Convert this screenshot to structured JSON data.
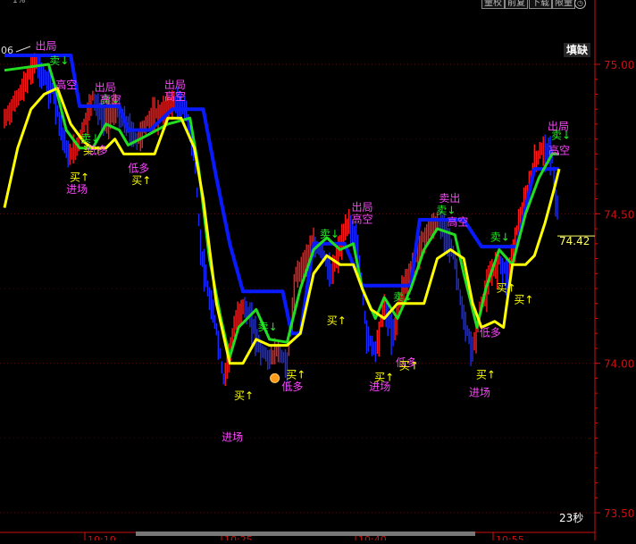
{
  "toolbar": {
    "buttons": [
      "量校",
      "前复",
      "下载",
      "限量"
    ],
    "topleft_label": "1%",
    "left_label": "06",
    "status_label": "填缺",
    "time_label": "23秒"
  },
  "colors": {
    "up": "#ff1a1a",
    "down": "#1a2aff",
    "blue_band": "#0a1aff",
    "green_line": "#22dd22",
    "yellow_line": "#ffff00",
    "axis": "#cc1111",
    "label_magenta": "#ff44ff",
    "label_yellow": "#ffff00",
    "label_green": "#22ee22"
  },
  "chart_data": {
    "type": "line",
    "ylim": [
      73.48,
      75.12
    ],
    "y_ticks": [
      "75.00",
      "74.50",
      "74.00",
      "73.50"
    ],
    "x_ticks": [
      "10:10",
      "10:25",
      "10:40",
      "10:55"
    ],
    "last_price": "74.42",
    "price": [
      [
        0,
        74.82
      ],
      [
        12,
        74.88
      ],
      [
        25,
        74.95
      ],
      [
        35,
        75.02
      ],
      [
        45,
        74.96
      ],
      [
        55,
        74.92
      ],
      [
        65,
        74.78
      ],
      [
        72,
        74.7
      ],
      [
        80,
        74.72
      ],
      [
        90,
        74.8
      ],
      [
        100,
        74.9
      ],
      [
        112,
        74.82
      ],
      [
        125,
        74.86
      ],
      [
        140,
        74.8
      ],
      [
        150,
        74.75
      ],
      [
        165,
        74.83
      ],
      [
        180,
        74.85
      ],
      [
        192,
        74.88
      ],
      [
        205,
        74.86
      ],
      [
        215,
        74.7
      ],
      [
        222,
        74.4
      ],
      [
        230,
        74.25
      ],
      [
        240,
        74.12
      ],
      [
        248,
        73.95
      ],
      [
        255,
        74.05
      ],
      [
        262,
        74.15
      ],
      [
        270,
        74.2
      ],
      [
        280,
        74.15
      ],
      [
        290,
        74.05
      ],
      [
        300,
        74.02
      ],
      [
        310,
        74.05
      ],
      [
        320,
        74.0
      ],
      [
        330,
        74.3
      ],
      [
        340,
        74.35
      ],
      [
        350,
        74.4
      ],
      [
        360,
        74.38
      ],
      [
        370,
        74.3
      ],
      [
        380,
        74.4
      ],
      [
        390,
        74.48
      ],
      [
        400,
        74.4
      ],
      [
        410,
        74.1
      ],
      [
        420,
        74.05
      ],
      [
        430,
        74.2
      ],
      [
        440,
        74.1
      ],
      [
        450,
        74.25
      ],
      [
        460,
        74.32
      ],
      [
        470,
        74.4
      ],
      [
        480,
        74.45
      ],
      [
        490,
        74.48
      ],
      [
        500,
        74.45
      ],
      [
        510,
        74.35
      ],
      [
        520,
        74.15
      ],
      [
        530,
        74.05
      ],
      [
        540,
        74.2
      ],
      [
        550,
        74.3
      ],
      [
        560,
        74.35
      ],
      [
        570,
        74.3
      ],
      [
        580,
        74.45
      ],
      [
        590,
        74.55
      ],
      [
        600,
        74.68
      ],
      [
        610,
        74.73
      ],
      [
        620,
        74.7
      ],
      [
        625,
        74.52
      ]
    ],
    "series": [
      {
        "points": [
          [
            0,
            75.03
          ],
          [
            75,
            75.03
          ],
          [
            85,
            74.86
          ],
          [
            130,
            74.86
          ],
          [
            140,
            74.78
          ],
          [
            165,
            74.78
          ],
          [
            190,
            74.85
          ],
          [
            225,
            74.85
          ],
          [
            240,
            74.62
          ],
          [
            255,
            74.4
          ],
          [
            270,
            74.24
          ],
          [
            315,
            74.24
          ],
          [
            325,
            74.1
          ],
          [
            335,
            74.1
          ],
          [
            350,
            74.4
          ],
          [
            385,
            74.4
          ],
          [
            405,
            74.26
          ],
          [
            460,
            74.26
          ],
          [
            470,
            74.48
          ],
          [
            520,
            74.48
          ],
          [
            540,
            74.39
          ],
          [
            580,
            74.39
          ],
          [
            600,
            74.65
          ],
          [
            628,
            74.65
          ]
        ]
      },
      {
        "points": [
          [
            0,
            74.98
          ],
          [
            50,
            75.0
          ],
          [
            60,
            74.9
          ],
          [
            70,
            74.78
          ],
          [
            85,
            74.72
          ],
          [
            100,
            74.72
          ],
          [
            115,
            74.8
          ],
          [
            130,
            74.78
          ],
          [
            140,
            74.73
          ],
          [
            160,
            74.76
          ],
          [
            185,
            74.8
          ],
          [
            210,
            74.82
          ],
          [
            220,
            74.65
          ],
          [
            232,
            74.35
          ],
          [
            245,
            74.15
          ],
          [
            255,
            74.02
          ],
          [
            265,
            74.12
          ],
          [
            285,
            74.18
          ],
          [
            300,
            74.08
          ],
          [
            320,
            74.07
          ],
          [
            335,
            74.25
          ],
          [
            350,
            74.38
          ],
          [
            365,
            74.42
          ],
          [
            380,
            74.38
          ],
          [
            395,
            74.4
          ],
          [
            405,
            74.25
          ],
          [
            420,
            74.15
          ],
          [
            430,
            74.22
          ],
          [
            445,
            74.15
          ],
          [
            460,
            74.25
          ],
          [
            475,
            74.38
          ],
          [
            490,
            74.45
          ],
          [
            510,
            74.43
          ],
          [
            520,
            74.3
          ],
          [
            535,
            74.12
          ],
          [
            545,
            74.25
          ],
          [
            560,
            74.38
          ],
          [
            575,
            74.33
          ],
          [
            590,
            74.5
          ],
          [
            605,
            74.62
          ],
          [
            620,
            74.7
          ],
          [
            628,
            74.7
          ]
        ]
      },
      {
        "points": [
          [
            0,
            74.52
          ],
          [
            15,
            74.72
          ],
          [
            30,
            74.85
          ],
          [
            45,
            74.9
          ],
          [
            60,
            74.92
          ],
          [
            75,
            74.8
          ],
          [
            90,
            74.74
          ],
          [
            100,
            74.72
          ],
          [
            115,
            74.72
          ],
          [
            125,
            74.75
          ],
          [
            135,
            74.7
          ],
          [
            155,
            74.7
          ],
          [
            170,
            74.7
          ],
          [
            185,
            74.82
          ],
          [
            200,
            74.82
          ],
          [
            215,
            74.72
          ],
          [
            225,
            74.55
          ],
          [
            240,
            74.2
          ],
          [
            255,
            74.0
          ],
          [
            270,
            74.0
          ],
          [
            285,
            74.08
          ],
          [
            300,
            74.06
          ],
          [
            320,
            74.06
          ],
          [
            335,
            74.1
          ],
          [
            350,
            74.3
          ],
          [
            365,
            74.36
          ],
          [
            380,
            74.33
          ],
          [
            395,
            74.33
          ],
          [
            405,
            74.25
          ],
          [
            415,
            74.18
          ],
          [
            430,
            74.15
          ],
          [
            445,
            74.2
          ],
          [
            460,
            74.2
          ],
          [
            475,
            74.2
          ],
          [
            490,
            74.35
          ],
          [
            505,
            74.38
          ],
          [
            520,
            74.35
          ],
          [
            530,
            74.2
          ],
          [
            540,
            74.12
          ],
          [
            555,
            74.14
          ],
          [
            565,
            74.12
          ],
          [
            575,
            74.33
          ],
          [
            590,
            74.33
          ],
          [
            600,
            74.36
          ],
          [
            612,
            74.47
          ],
          [
            622,
            74.58
          ],
          [
            628,
            74.65
          ]
        ]
      }
    ],
    "annotations": [
      {
        "text": "出局",
        "x": 47,
        "y": 75.05,
        "color": "magenta"
      },
      {
        "text": "卖↓",
        "x": 62,
        "y": 75.0,
        "color": "green"
      },
      {
        "text": "高空",
        "x": 70,
        "y": 74.92,
        "color": "magenta"
      },
      {
        "text": "出局",
        "x": 114,
        "y": 74.91,
        "color": "magenta"
      },
      {
        "text": "卖↓",
        "x": 120,
        "y": 74.87,
        "color": "green"
      },
      {
        "text": "高空",
        "x": 120,
        "y": 74.87,
        "color": "magenta"
      },
      {
        "text": "出局",
        "x": 193,
        "y": 74.92,
        "color": "magenta"
      },
      {
        "text": "高空",
        "x": 193,
        "y": 74.88,
        "color": "magenta"
      },
      {
        "text": "卖↓",
        "x": 97,
        "y": 74.74,
        "color": "green"
      },
      {
        "text": "买↑",
        "x": 100,
        "y": 74.7,
        "color": "yellow"
      },
      {
        "text": "低多",
        "x": 105,
        "y": 74.7,
        "color": "magenta"
      },
      {
        "text": "低多",
        "x": 152,
        "y": 74.64,
        "color": "magenta"
      },
      {
        "text": "买↑",
        "x": 155,
        "y": 74.6,
        "color": "yellow"
      },
      {
        "text": "买↑",
        "x": 85,
        "y": 74.61,
        "color": "yellow"
      },
      {
        "text": "进场",
        "x": 82,
        "y": 74.57,
        "color": "magenta"
      },
      {
        "text": "卖↓",
        "x": 298,
        "y": 74.11,
        "color": "green"
      },
      {
        "text": "买↑",
        "x": 330,
        "y": 73.95,
        "color": "yellow"
      },
      {
        "text": "低多",
        "x": 326,
        "y": 73.91,
        "color": "magenta"
      },
      {
        "text": "买↑",
        "x": 271,
        "y": 73.88,
        "color": "yellow"
      },
      {
        "text": "进场",
        "x": 258,
        "y": 73.74,
        "color": "magenta"
      },
      {
        "text": "出局",
        "x": 405,
        "y": 74.51,
        "color": "magenta"
      },
      {
        "text": "高空",
        "x": 405,
        "y": 74.47,
        "color": "magenta"
      },
      {
        "text": "卖↓",
        "x": 368,
        "y": 74.42,
        "color": "green"
      },
      {
        "text": "买↑",
        "x": 376,
        "y": 74.13,
        "color": "yellow"
      },
      {
        "text": "卖↓",
        "x": 451,
        "y": 74.21,
        "color": "green"
      },
      {
        "text": "低多",
        "x": 455,
        "y": 73.99,
        "color": "magenta"
      },
      {
        "text": "买↑",
        "x": 458,
        "y": 73.98,
        "color": "yellow"
      },
      {
        "text": "买↑",
        "x": 430,
        "y": 73.94,
        "color": "yellow"
      },
      {
        "text": "进场",
        "x": 425,
        "y": 73.91,
        "color": "magenta"
      },
      {
        "text": "卖出",
        "x": 504,
        "y": 74.54,
        "color": "magenta"
      },
      {
        "text": "高空",
        "x": 513,
        "y": 74.46,
        "color": "magenta"
      },
      {
        "text": "卖↓",
        "x": 500,
        "y": 74.5,
        "color": "green"
      },
      {
        "text": "卖↓",
        "x": 561,
        "y": 74.41,
        "color": "green"
      },
      {
        "text": "买↑",
        "x": 568,
        "y": 74.24,
        "color": "yellow"
      },
      {
        "text": "买↑",
        "x": 588,
        "y": 74.2,
        "color": "yellow"
      },
      {
        "text": "低多",
        "x": 550,
        "y": 74.09,
        "color": "magenta"
      },
      {
        "text": "买↑",
        "x": 545,
        "y": 73.95,
        "color": "yellow"
      },
      {
        "text": "进场",
        "x": 538,
        "y": 73.89,
        "color": "magenta"
      },
      {
        "text": "出局",
        "x": 627,
        "y": 74.78,
        "color": "magenta"
      },
      {
        "text": "卖↓",
        "x": 630,
        "y": 74.75,
        "color": "green"
      },
      {
        "text": "高空",
        "x": 628,
        "y": 74.7,
        "color": "magenta"
      }
    ]
  }
}
